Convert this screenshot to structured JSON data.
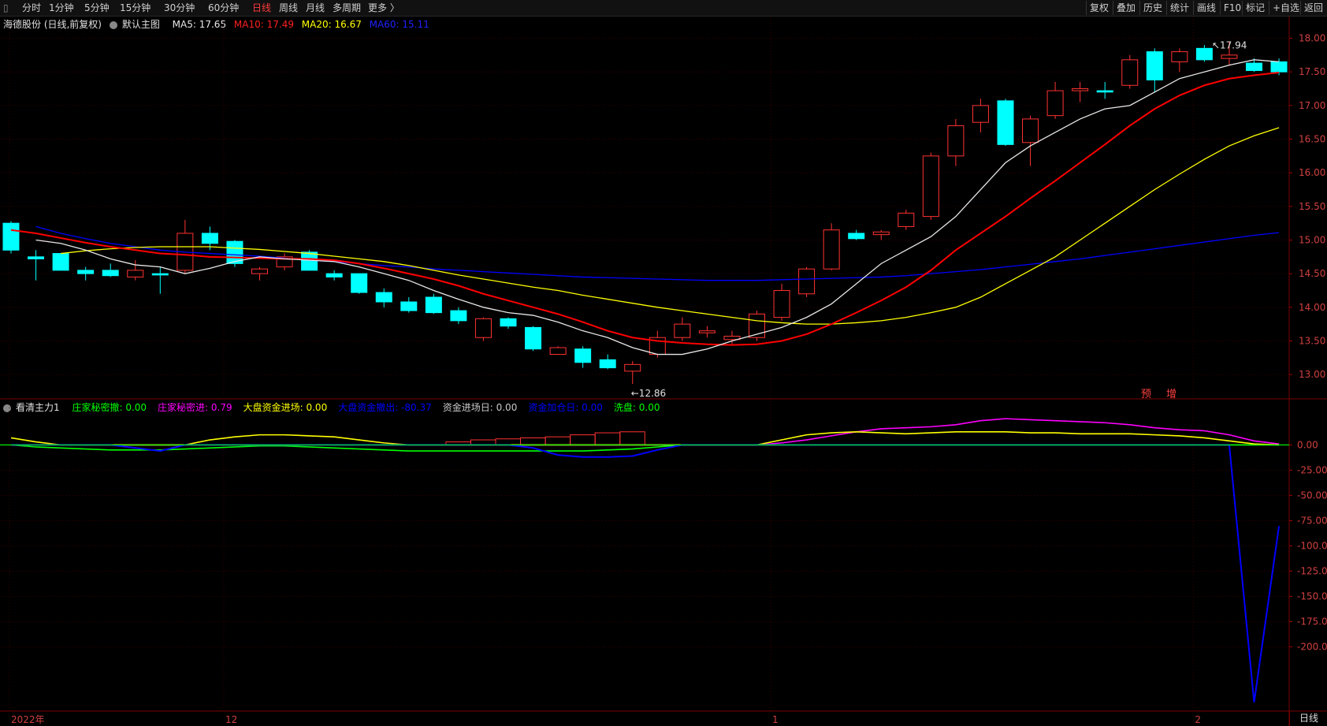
{
  "toolbar": {
    "periods": [
      "分时",
      "1分钟",
      "5分钟",
      "15分钟",
      "30分钟",
      "60分钟",
      "日线",
      "周线",
      "月线",
      "多周期",
      "更多 〉"
    ],
    "active_period": "日线",
    "right_tools": [
      "复权",
      "叠加",
      "历史",
      "统计",
      "画线",
      "F10",
      "标记",
      "+自选",
      "返回"
    ]
  },
  "main_header": {
    "stock": "海德股份 (日线,前复权)",
    "template": "默认主图",
    "ma5": "MA5: 17.65",
    "ma10": "MA10: 17.49",
    "ma20": "MA20: 16.67",
    "ma60": "MA60: 15.11"
  },
  "sub_header": {
    "indicator": "看清主力1",
    "items": [
      {
        "text": "庄家秘密撤: 0.00",
        "color": "#00ff00"
      },
      {
        "text": "庄家秘密进: 0.79",
        "color": "#ff00ff"
      },
      {
        "text": "大盘资金进场: 0.00",
        "color": "#ffff00"
      },
      {
        "text": "大盘资金撤出: -80.37",
        "color": "#0000ff"
      },
      {
        "text": "资金进场日: 0.00",
        "color": "#c8c8c8"
      },
      {
        "text": "资金加仓日: 0.00",
        "color": "#0000ff"
      },
      {
        "text": "洗盘: 0.00",
        "color": "#00ff00"
      }
    ]
  },
  "markers": {
    "high_label": "17.94",
    "low_label": "12.86",
    "forecast_label": "预",
    "warn_label": "增"
  },
  "x_axis_labels": [
    "2022年",
    "12",
    "1",
    "2"
  ],
  "period_label": "日线",
  "colors": {
    "up": "#ff3232",
    "down": "#00ffff",
    "ma5": "#e8e8e8",
    "ma10": "#ff0000",
    "ma20": "#ffff00",
    "ma60": "#0000ff"
  },
  "chart_data": [
    {
      "type": "candlestick",
      "title": "",
      "y_ticks": [
        18.0,
        17.5,
        17.0,
        16.5,
        16.0,
        15.5,
        15.0,
        14.5,
        14.0,
        13.5,
        13.0
      ],
      "ylim": [
        12.65,
        18.1
      ],
      "candles": [
        {
          "o": 15.25,
          "h": 15.28,
          "l": 14.8,
          "c": 14.85
        },
        {
          "o": 14.75,
          "h": 14.85,
          "l": 14.4,
          "c": 14.72
        },
        {
          "o": 14.8,
          "h": 14.8,
          "l": 14.55,
          "c": 14.55
        },
        {
          "o": 14.55,
          "h": 14.6,
          "l": 14.4,
          "c": 14.5
        },
        {
          "o": 14.55,
          "h": 14.65,
          "l": 14.45,
          "c": 14.47
        },
        {
          "o": 14.45,
          "h": 14.7,
          "l": 14.4,
          "c": 14.55
        },
        {
          "o": 14.5,
          "h": 14.6,
          "l": 14.2,
          "c": 14.48
        },
        {
          "o": 14.55,
          "h": 15.3,
          "l": 14.5,
          "c": 15.1
        },
        {
          "o": 15.1,
          "h": 15.2,
          "l": 14.85,
          "c": 14.95
        },
        {
          "o": 14.98,
          "h": 15.0,
          "l": 14.6,
          "c": 14.65
        },
        {
          "o": 14.5,
          "h": 14.6,
          "l": 14.4,
          "c": 14.57
        },
        {
          "o": 14.6,
          "h": 14.8,
          "l": 14.55,
          "c": 14.75
        },
        {
          "o": 14.82,
          "h": 14.85,
          "l": 14.55,
          "c": 14.55
        },
        {
          "o": 14.5,
          "h": 14.55,
          "l": 14.4,
          "c": 14.45
        },
        {
          "o": 14.5,
          "h": 14.5,
          "l": 14.2,
          "c": 14.22
        },
        {
          "o": 14.22,
          "h": 14.28,
          "l": 14.0,
          "c": 14.08
        },
        {
          "o": 14.08,
          "h": 14.15,
          "l": 13.92,
          "c": 13.95
        },
        {
          "o": 14.15,
          "h": 14.2,
          "l": 13.9,
          "c": 13.92
        },
        {
          "o": 13.95,
          "h": 14.0,
          "l": 13.75,
          "c": 13.8
        },
        {
          "o": 13.55,
          "h": 13.85,
          "l": 13.5,
          "c": 13.83
        },
        {
          "o": 13.83,
          "h": 13.85,
          "l": 13.68,
          "c": 13.72
        },
        {
          "o": 13.7,
          "h": 13.72,
          "l": 13.35,
          "c": 13.38
        },
        {
          "o": 13.3,
          "h": 13.42,
          "l": 13.3,
          "c": 13.4
        },
        {
          "o": 13.38,
          "h": 13.42,
          "l": 13.1,
          "c": 13.18
        },
        {
          "o": 13.22,
          "h": 13.3,
          "l": 13.08,
          "c": 13.1
        },
        {
          "o": 13.05,
          "h": 13.2,
          "l": 12.86,
          "c": 13.15
        },
        {
          "o": 13.3,
          "h": 13.65,
          "l": 13.25,
          "c": 13.55
        },
        {
          "o": 13.55,
          "h": 13.85,
          "l": 13.5,
          "c": 13.75
        },
        {
          "o": 13.62,
          "h": 13.72,
          "l": 13.55,
          "c": 13.65
        },
        {
          "o": 13.52,
          "h": 13.65,
          "l": 13.45,
          "c": 13.57
        },
        {
          "o": 13.55,
          "h": 13.95,
          "l": 13.5,
          "c": 13.9
        },
        {
          "o": 13.85,
          "h": 14.35,
          "l": 13.8,
          "c": 14.25
        },
        {
          "o": 14.2,
          "h": 14.6,
          "l": 14.15,
          "c": 14.57
        },
        {
          "o": 14.57,
          "h": 15.25,
          "l": 14.55,
          "c": 15.15
        },
        {
          "o": 15.1,
          "h": 15.15,
          "l": 15.0,
          "c": 15.02
        },
        {
          "o": 15.08,
          "h": 15.15,
          "l": 15.0,
          "c": 15.12
        },
        {
          "o": 15.2,
          "h": 15.45,
          "l": 15.15,
          "c": 15.4
        },
        {
          "o": 15.35,
          "h": 16.3,
          "l": 15.3,
          "c": 16.25
        },
        {
          "o": 16.25,
          "h": 16.8,
          "l": 16.1,
          "c": 16.7
        },
        {
          "o": 16.75,
          "h": 17.1,
          "l": 16.6,
          "c": 17.0
        },
        {
          "o": 17.07,
          "h": 17.1,
          "l": 16.4,
          "c": 16.42
        },
        {
          "o": 16.45,
          "h": 16.85,
          "l": 16.1,
          "c": 16.8
        },
        {
          "o": 16.85,
          "h": 17.35,
          "l": 16.8,
          "c": 17.22
        },
        {
          "o": 17.22,
          "h": 17.35,
          "l": 17.05,
          "c": 17.25
        },
        {
          "o": 17.22,
          "h": 17.35,
          "l": 17.1,
          "c": 17.2
        },
        {
          "o": 17.3,
          "h": 17.75,
          "l": 17.25,
          "c": 17.68
        },
        {
          "o": 17.8,
          "h": 17.85,
          "l": 17.2,
          "c": 17.38
        },
        {
          "o": 17.65,
          "h": 17.85,
          "l": 17.5,
          "c": 17.8
        },
        {
          "o": 17.85,
          "h": 17.9,
          "l": 17.65,
          "c": 17.68
        },
        {
          "o": 17.7,
          "h": 17.94,
          "l": 17.6,
          "c": 17.75
        },
        {
          "o": 17.63,
          "h": 17.7,
          "l": 17.5,
          "c": 17.52
        },
        {
          "o": 17.65,
          "h": 17.7,
          "l": 17.45,
          "c": 17.5
        }
      ],
      "ma5": [
        15.0,
        14.95,
        14.85,
        14.72,
        14.63,
        14.6,
        14.5,
        14.58,
        14.68,
        14.75,
        14.72,
        14.7,
        14.68,
        14.6,
        14.5,
        14.4,
        14.25,
        14.12,
        14.0,
        13.92,
        13.88,
        13.78,
        13.65,
        13.55,
        13.4,
        13.3,
        13.3,
        13.38,
        13.5,
        13.6,
        13.7,
        13.85,
        14.05,
        14.35,
        14.65,
        14.85,
        15.05,
        15.35,
        15.75,
        16.15,
        16.4,
        16.6,
        16.8,
        16.95,
        17.0,
        17.2,
        17.4,
        17.5,
        17.6,
        17.68,
        17.65
      ],
      "ma10": [
        15.15,
        15.1,
        15.03,
        14.96,
        14.9,
        14.85,
        14.8,
        14.78,
        14.75,
        14.74,
        14.73,
        14.72,
        14.72,
        14.7,
        14.65,
        14.58,
        14.5,
        14.42,
        14.32,
        14.2,
        14.1,
        14.0,
        13.9,
        13.78,
        13.65,
        13.55,
        13.5,
        13.47,
        13.45,
        13.44,
        13.45,
        13.5,
        13.6,
        13.75,
        13.92,
        14.1,
        14.3,
        14.55,
        14.85,
        15.1,
        15.35,
        15.62,
        15.88,
        16.15,
        16.42,
        16.7,
        16.95,
        17.15,
        17.3,
        17.4,
        17.45,
        17.49
      ],
      "ma20": [
        14.8,
        14.84,
        14.87,
        14.89,
        14.9,
        14.9,
        14.9,
        14.88,
        14.86,
        14.83,
        14.8,
        14.76,
        14.72,
        14.68,
        14.62,
        14.55,
        14.48,
        14.42,
        14.36,
        14.3,
        14.25,
        14.18,
        14.12,
        14.06,
        14.0,
        13.95,
        13.9,
        13.85,
        13.8,
        13.77,
        13.75,
        13.75,
        13.77,
        13.8,
        13.85,
        13.92,
        14.0,
        14.15,
        14.35,
        14.55,
        14.75,
        15.0,
        15.25,
        15.5,
        15.75,
        15.98,
        16.2,
        16.4,
        16.55,
        16.67
      ],
      "ma60": [
        15.2,
        15.1,
        15.02,
        14.95,
        14.9,
        14.85,
        14.82,
        14.8,
        14.78,
        14.76,
        14.73,
        14.7,
        14.68,
        14.65,
        14.62,
        14.6,
        14.57,
        14.55,
        14.53,
        14.51,
        14.49,
        14.47,
        14.45,
        14.44,
        14.43,
        14.42,
        14.41,
        14.4,
        14.4,
        14.4,
        14.41,
        14.42,
        14.43,
        14.44,
        14.45,
        14.47,
        14.5,
        14.53,
        14.56,
        14.6,
        14.64,
        14.68,
        14.72,
        14.77,
        14.82,
        14.87,
        14.92,
        14.97,
        15.02,
        15.07,
        15.11
      ]
    },
    {
      "type": "line",
      "title": "",
      "y_ticks": [
        0.0,
        -25.0,
        -50.0,
        -75.0,
        -100.0,
        -125.0,
        -150.0,
        -175.0,
        -200.0
      ],
      "ylim": [
        -262,
        30
      ],
      "series": [
        {
          "name": "庄家秘密撤",
          "color": "#00ff00",
          "values": [
            0,
            -2,
            -3,
            -4,
            -5,
            -5,
            -5,
            -4,
            -3,
            -2,
            -1,
            -1,
            -2,
            -3,
            -4,
            -5,
            -6,
            -6,
            -6,
            -6,
            -6,
            -6,
            -6,
            -6,
            -5,
            -4,
            -2,
            0,
            0,
            0,
            0,
            0,
            0,
            0,
            0,
            0,
            0,
            0,
            0,
            0,
            0,
            0,
            0,
            0,
            0,
            0,
            0,
            0,
            0,
            0,
            0,
            0
          ]
        },
        {
          "name": "庄家秘密进",
          "color": "#ff00ff",
          "values": [
            0,
            0,
            0,
            0,
            0,
            0,
            0,
            0,
            0,
            0,
            0,
            0,
            0,
            0,
            0,
            0,
            0,
            0,
            0,
            0,
            0,
            0,
            0,
            0,
            0,
            0,
            0,
            0,
            0,
            0,
            0,
            2,
            5,
            9,
            13,
            16,
            17,
            18,
            20,
            24,
            26,
            25,
            24,
            23,
            22,
            20,
            17,
            15,
            14,
            10,
            4,
            1
          ]
        },
        {
          "name": "大盘资金进场",
          "color": "#ffff00",
          "values": [
            7,
            3,
            0,
            0,
            0,
            0,
            0,
            0,
            5,
            8,
            10,
            10,
            9,
            8,
            5,
            2,
            0,
            0,
            0,
            0,
            0,
            0,
            0,
            0,
            0,
            0,
            0,
            0,
            0,
            0,
            0,
            5,
            10,
            12,
            13,
            12,
            11,
            12,
            13,
            13,
            13,
            12,
            12,
            11,
            11,
            11,
            10,
            9,
            7,
            4,
            1,
            0
          ]
        },
        {
          "name": "大盘资金撤出",
          "color": "#0000ff",
          "values": [
            0,
            0,
            0,
            0,
            0,
            -3,
            -6,
            0,
            0,
            0,
            0,
            0,
            0,
            0,
            0,
            0,
            0,
            0,
            0,
            0,
            0,
            -3,
            -10,
            -12,
            -12,
            -11,
            -5,
            0,
            0,
            0,
            0,
            0,
            0,
            0,
            0,
            0,
            0,
            0,
            0,
            0,
            0,
            0,
            0,
            0,
            0,
            0,
            0,
            0,
            0,
            0,
            -255,
            -80.37
          ]
        },
        {
          "name": "资金加仓日",
          "color": "#ff3232",
          "bars": [
            0,
            0,
            0,
            0,
            0,
            0,
            0,
            0,
            0,
            0,
            0,
            0,
            0,
            0,
            0,
            0,
            0,
            0,
            3,
            5,
            6,
            7,
            8,
            10,
            12,
            13,
            0,
            0,
            0,
            0,
            0,
            0,
            0,
            0,
            0,
            0,
            0,
            0,
            0,
            0,
            0,
            0,
            0,
            0,
            0,
            0,
            0,
            0,
            0,
            0,
            0,
            0
          ]
        }
      ]
    }
  ]
}
